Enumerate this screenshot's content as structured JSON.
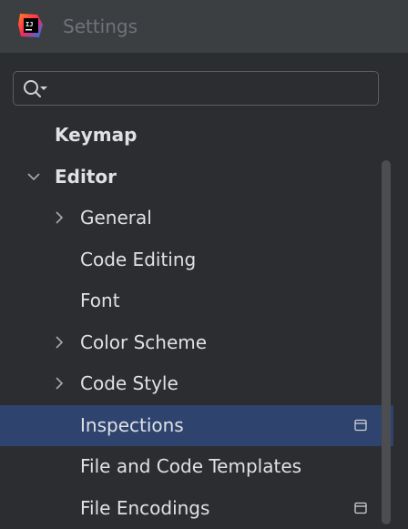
{
  "window": {
    "title": "Settings",
    "logo_icon": "intellij-idea-logo-icon"
  },
  "search": {
    "value": "",
    "placeholder": "",
    "icon": "search-with-dropdown-icon"
  },
  "tree": {
    "items": [
      {
        "label": "Keymap",
        "level": 0,
        "bold": true,
        "expander": "none",
        "selected": false,
        "page_icon": false
      },
      {
        "label": "Editor",
        "level": 0,
        "bold": true,
        "expander": "expanded",
        "selected": false,
        "page_icon": false
      },
      {
        "label": "General",
        "level": 1,
        "bold": false,
        "expander": "collapsed",
        "selected": false,
        "page_icon": false
      },
      {
        "label": "Code Editing",
        "level": 1,
        "bold": false,
        "expander": "none",
        "selected": false,
        "page_icon": false
      },
      {
        "label": "Font",
        "level": 1,
        "bold": false,
        "expander": "none",
        "selected": false,
        "page_icon": false
      },
      {
        "label": "Color Scheme",
        "level": 1,
        "bold": false,
        "expander": "collapsed",
        "selected": false,
        "page_icon": false
      },
      {
        "label": "Code Style",
        "level": 1,
        "bold": false,
        "expander": "collapsed",
        "selected": false,
        "page_icon": false
      },
      {
        "label": "Inspections",
        "level": 1,
        "bold": false,
        "expander": "none",
        "selected": true,
        "page_icon": true
      },
      {
        "label": "File and Code Templates",
        "level": 1,
        "bold": false,
        "expander": "none",
        "selected": false,
        "page_icon": false
      },
      {
        "label": "File Encodings",
        "level": 1,
        "bold": false,
        "expander": "none",
        "selected": false,
        "page_icon": true
      }
    ]
  },
  "colors": {
    "panel_background": "#2b2d30",
    "titlebar_background": "#3c3f41",
    "selection": "#2e436e",
    "text": "#dfe1e5",
    "muted_text": "#6f737a"
  }
}
